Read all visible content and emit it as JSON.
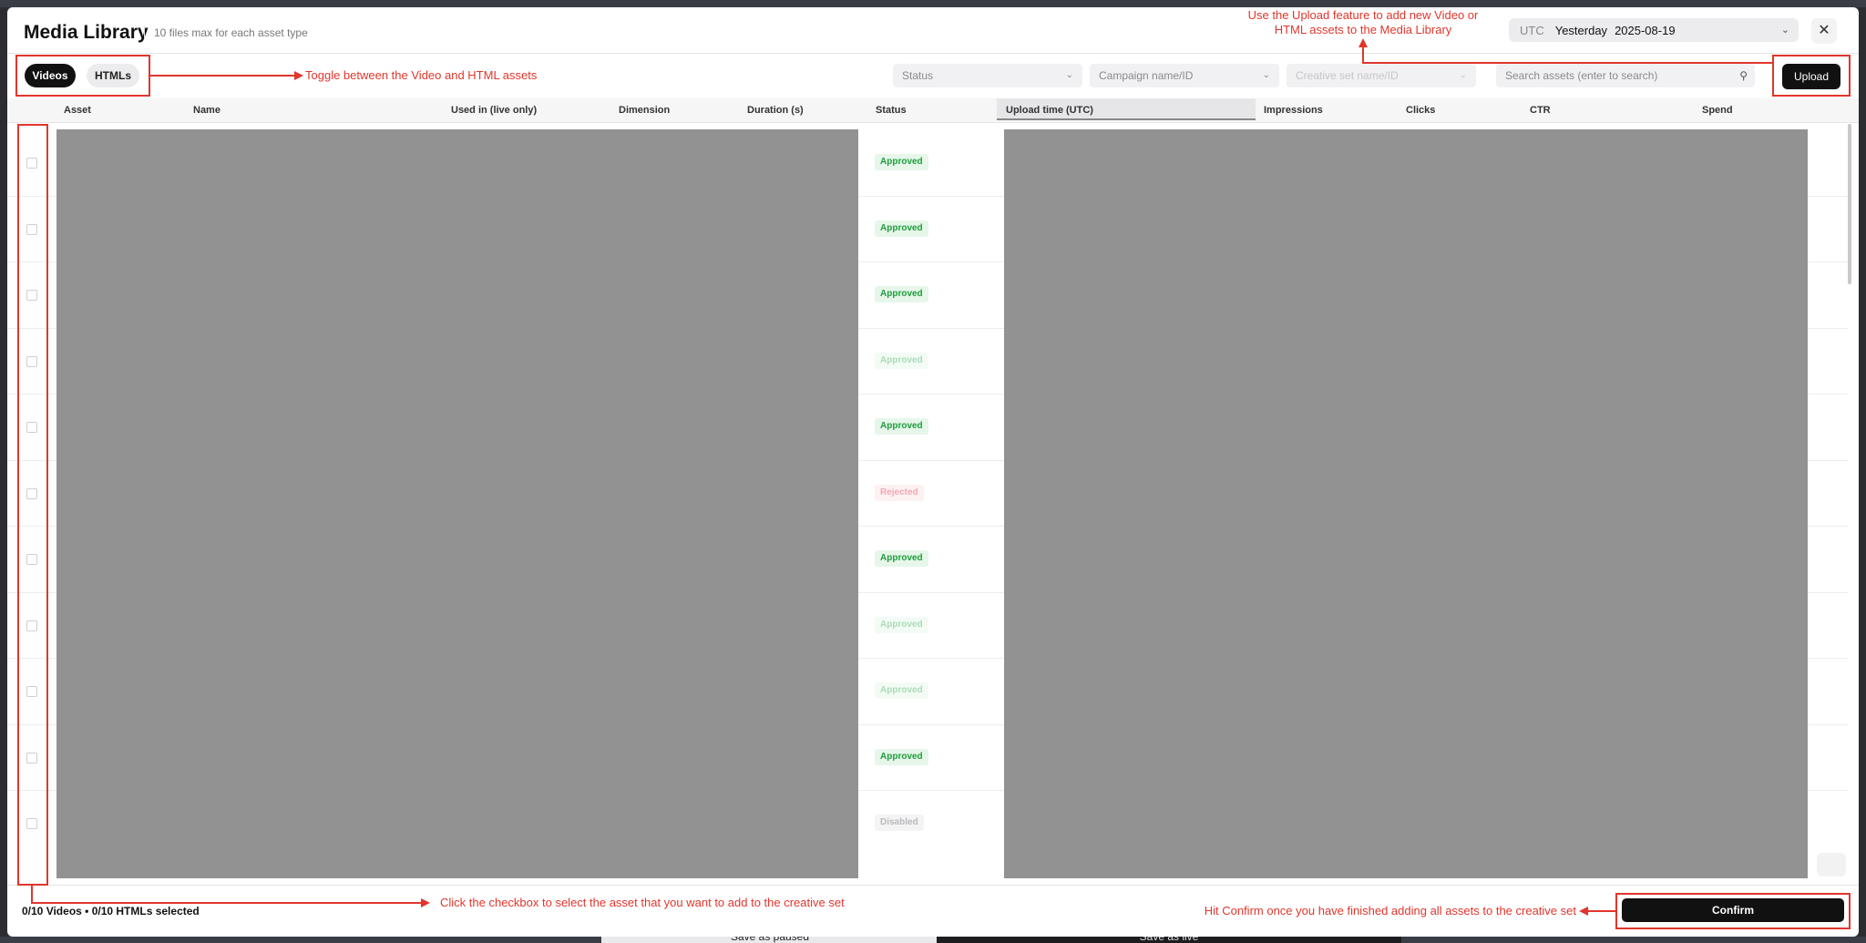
{
  "background": {
    "save_paused_label": "Save as paused",
    "save_live_label": "Save as live"
  },
  "modal": {
    "title": "Media Library",
    "subtitle": "10 files max for each asset type",
    "date_picker": {
      "timezone": "UTC",
      "preset": "Yesterday",
      "date": "2025-08-19"
    },
    "close_icon": "close-icon"
  },
  "toolbar": {
    "toggle": {
      "videos_label": "Videos",
      "htmls_label": "HTMLs",
      "active": "Videos"
    },
    "filters": {
      "status_placeholder": "Status",
      "campaign_placeholder": "Campaign name/ID",
      "creative_set_placeholder": "Creative set name/ID",
      "search_placeholder": "Search assets (enter to search)"
    },
    "upload_label": "Upload"
  },
  "table": {
    "columns": [
      "Asset",
      "Name",
      "Used in (live only)",
      "Dimension",
      "Duration (s)",
      "Status",
      "Upload time (UTC)",
      "Impressions",
      "Clicks",
      "CTR",
      "Spend"
    ],
    "sorted_column": "Upload time (UTC)",
    "rows": [
      {
        "status": "Approved",
        "style": "approved"
      },
      {
        "status": "Approved",
        "style": "approved"
      },
      {
        "status": "Approved",
        "style": "approved"
      },
      {
        "status": "Approved",
        "style": "faded-approved"
      },
      {
        "status": "Approved",
        "style": "approved"
      },
      {
        "status": "Rejected",
        "style": "faded-rejected"
      },
      {
        "status": "Approved",
        "style": "approved"
      },
      {
        "status": "Approved",
        "style": "faded-approved"
      },
      {
        "status": "Approved",
        "style": "faded-approved"
      },
      {
        "status": "Approved",
        "style": "approved"
      },
      {
        "status": "Disabled",
        "style": "disabled"
      }
    ]
  },
  "footer": {
    "selection_summary": "0/10 Videos • 0/10 HTMLs selected",
    "confirm_label": "Confirm"
  },
  "annotations": {
    "toggle_note": "Toggle between the Video and HTML assets",
    "upload_note_line1": "Use the Upload feature to add new Video or",
    "upload_note_line2": "HTML assets to the Media Library",
    "checkbox_note": "Click the checkbox to select the asset that you want to add to the creative set",
    "confirm_note": "Hit Confirm once you have finished adding all assets to the creative set",
    "color": "#e0362c"
  }
}
